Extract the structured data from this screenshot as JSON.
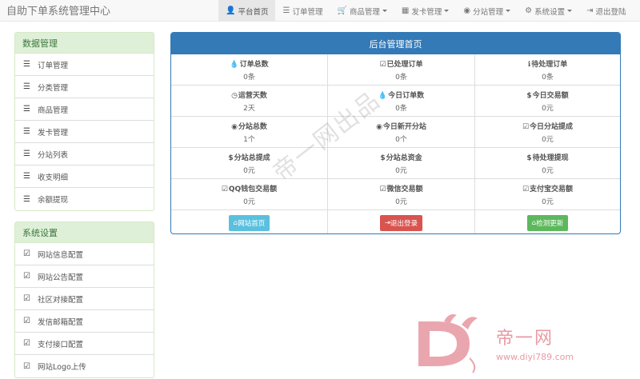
{
  "brand": "自助下单系统管理中心",
  "nav": [
    {
      "label": "平台首页",
      "icon": "user-icon",
      "glyph": "👤",
      "active": true
    },
    {
      "label": "订单管理",
      "icon": "list-icon",
      "glyph": "☰"
    },
    {
      "label": "商品管理",
      "icon": "cart-icon",
      "glyph": "🛒",
      "dropdown": true
    },
    {
      "label": "发卡管理",
      "icon": "grid-icon",
      "glyph": "▦",
      "dropdown": true
    },
    {
      "label": "分站管理",
      "icon": "globe-icon",
      "glyph": "◉",
      "dropdown": true
    },
    {
      "label": "系统设置",
      "icon": "gear-icon",
      "glyph": "⚙",
      "dropdown": true
    },
    {
      "label": "退出登陆",
      "icon": "logout-icon",
      "glyph": "⇥"
    }
  ],
  "data_panel": {
    "title": "数据管理",
    "items": [
      "订单管理",
      "分类管理",
      "商品管理",
      "发卡管理",
      "分站列表",
      "收支明细",
      "余额提现"
    ]
  },
  "system_panel": {
    "title": "系统设置",
    "items": [
      "网站信息配置",
      "网站公告配置",
      "社区对接配置",
      "发信邮箱配置",
      "支付接口配置",
      "网站Logo上传"
    ]
  },
  "main": {
    "title": "后台管理首页",
    "stats": [
      {
        "label": "订单总数",
        "value": "0条",
        "icon": "tint-icon",
        "glyph": "💧"
      },
      {
        "label": "已处理订单",
        "value": "0条",
        "icon": "check-icon",
        "glyph": "☑"
      },
      {
        "label": "待处理订单",
        "value": "0条",
        "icon": "info-icon",
        "glyph": "ℹ"
      },
      {
        "label": "运营天数",
        "value": "2天",
        "icon": "clock-icon",
        "glyph": "◷"
      },
      {
        "label": "今日订单数",
        "value": "0条",
        "icon": "tint-icon",
        "glyph": "💧"
      },
      {
        "label": "今日交易额",
        "value": "0元",
        "icon": "dollar-icon",
        "glyph": "$"
      },
      {
        "label": "分站总数",
        "value": "1个",
        "icon": "globe-icon",
        "glyph": "◉"
      },
      {
        "label": "今日新开分站",
        "value": "0个",
        "icon": "globe-icon",
        "glyph": "◉"
      },
      {
        "label": "今日分站提成",
        "value": "0元",
        "icon": "check-icon",
        "glyph": "☑"
      },
      {
        "label": "分站总提成",
        "value": "0元",
        "icon": "dollar-icon",
        "glyph": "$"
      },
      {
        "label": "分站总资金",
        "value": "0元",
        "icon": "dollar-icon",
        "glyph": "$"
      },
      {
        "label": "待处理提现",
        "value": "0元",
        "icon": "dollar-icon",
        "glyph": "$"
      },
      {
        "label": "QQ钱包交易额",
        "value": "0元",
        "icon": "check-icon",
        "glyph": "☑"
      },
      {
        "label": "微信交易额",
        "value": "0元",
        "icon": "check-icon",
        "glyph": "☑"
      },
      {
        "label": "支付宝交易额",
        "value": "0元",
        "icon": "check-icon",
        "glyph": "☑"
      }
    ],
    "buttons": {
      "home": "网站首页",
      "logout": "退出登录",
      "update": "检测更新"
    }
  },
  "watermark": "帝一网出品",
  "logo": {
    "name": "帝一网",
    "url": "www.diyi789.com"
  }
}
